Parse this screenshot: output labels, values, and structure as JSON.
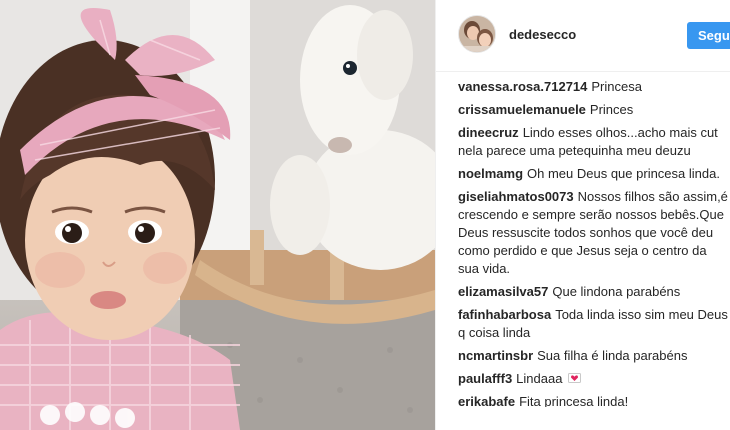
{
  "post": {
    "photo_alt": "",
    "author": {
      "username": "dedesecco",
      "follow_label": "Seguir"
    },
    "comments": [
      {
        "user": "vanessa.rosa.712714",
        "text": "Princesa"
      },
      {
        "user": "crissamuelemanuele",
        "text": "Princes"
      },
      {
        "user": "dineecruz",
        "text": "Lindo esses olhos...acho mais cut nela parece uma petequinha meu deuzu"
      },
      {
        "user": "noelmamg",
        "text": "Oh meu Deus que princesa linda."
      },
      {
        "user": "giseliahmatos0073",
        "text": "Nossos filhos são assim,é crescendo e sempre serão nossos bebês.Que Deus ressuscite todos sonhos que você deu como perdido e que Jesus seja o centro da sua vida."
      },
      {
        "user": "elizamasilva57",
        "text": "Que lindona parabéns"
      },
      {
        "user": "fafinhabarbosa",
        "text": "Toda linda isso sim meu Deus q coisa linda"
      },
      {
        "user": "ncmartinsbr",
        "text": "Sua filha é linda parabéns"
      },
      {
        "user": "paulafff3",
        "text": "Lindaaa",
        "emoji": "heart-letter-icon"
      },
      {
        "user": "erikabafe",
        "text": "Fita princesa linda!"
      }
    ]
  },
  "colors": {
    "accent": "#3897f0",
    "text": "#262626",
    "divider": "#efefef"
  }
}
